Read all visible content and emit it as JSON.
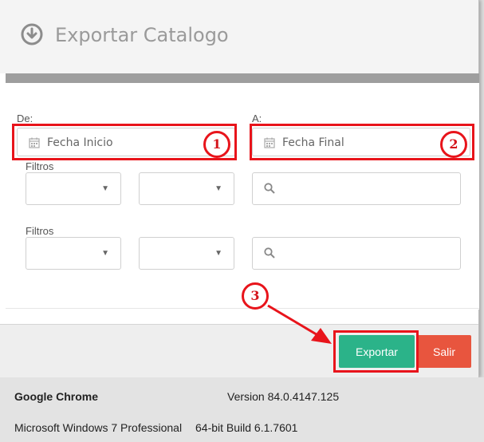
{
  "modal": {
    "title": "Exportar Catalogo",
    "header_icon": "download-circle-icon",
    "from_label": "De:",
    "to_label": "A:",
    "start_date_placeholder": "Fecha Inicio",
    "end_date_placeholder": "Fecha Final",
    "filters": [
      {
        "label": "Filtros",
        "select1": "",
        "select2": "",
        "search": ""
      },
      {
        "label": "Filtros",
        "select1": "",
        "select2": "",
        "search": ""
      }
    ],
    "export_button": "Exportar",
    "exit_button": "Salir"
  },
  "annotations": {
    "badge1": "1",
    "badge2": "2",
    "badge3": "3",
    "color": "#e8141b"
  },
  "system_info": {
    "browser": "Google Chrome",
    "version": "Version 84.0.4147.125",
    "os": "Microsoft Windows 7 Professional",
    "build": "64-bit Build 6.1.7601"
  },
  "colors": {
    "export_button": "#2bb389",
    "exit_button": "#e8553e",
    "progress_bar": "#9e9e9e"
  }
}
